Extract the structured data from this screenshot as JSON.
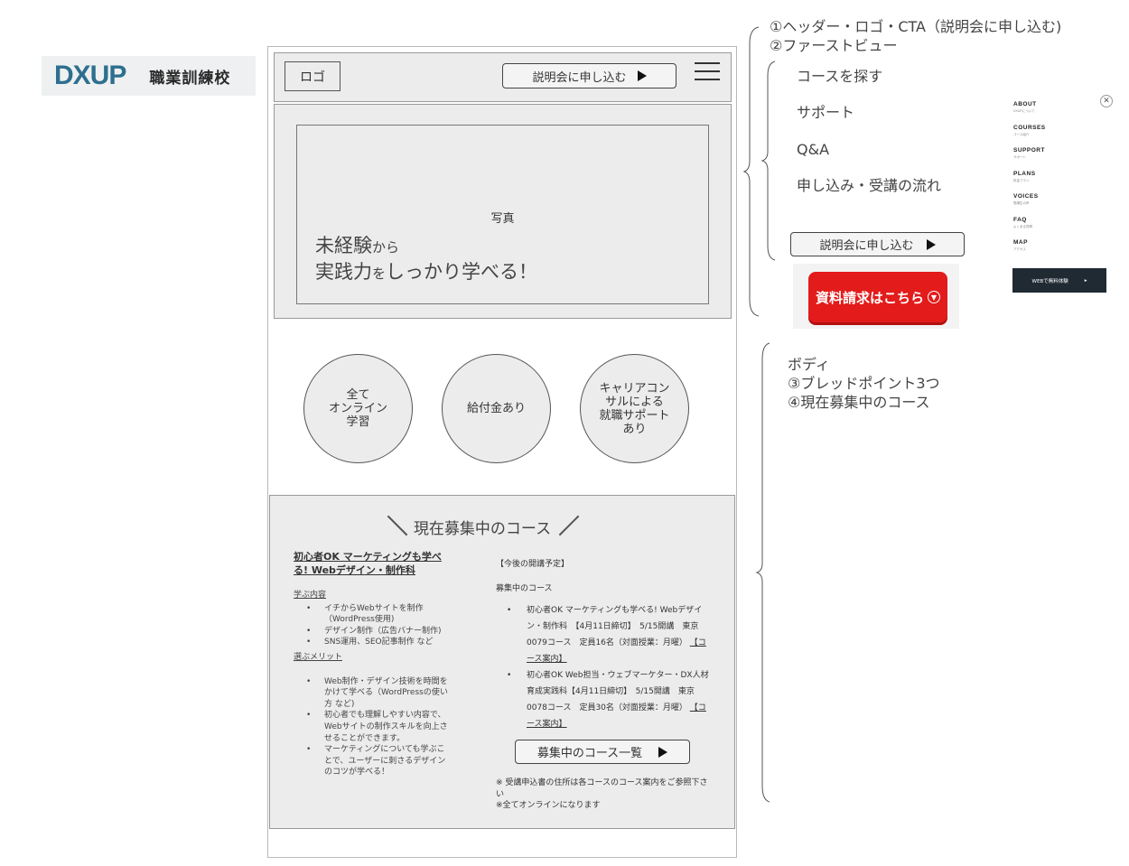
{
  "brand": {
    "mark": "DXUP",
    "text": "職業訓練校"
  },
  "header": {
    "logo_label": "ロゴ",
    "cta_label": "説明会に申し込む"
  },
  "hero": {
    "photo_label": "写真",
    "catch_line1_a": "未経験",
    "catch_line1_b": "から",
    "catch_line2_a": "実践力",
    "catch_line2_b": "を",
    "catch_line2_c": "しっかり学べる！"
  },
  "bullets": [
    {
      "lines": [
        "全て",
        "オンライン",
        "学習"
      ]
    },
    {
      "lines": [
        "給付金あり"
      ]
    },
    {
      "lines": [
        "キャリアコン",
        "サルによる",
        "就職サポート",
        "あり"
      ]
    }
  ],
  "courses": {
    "title": "現在募集中のコース",
    "left": {
      "heading": "初心者OK マーケティングも学べる! Webデザイン・制作科",
      "learn_label": "学ぶ内容",
      "learn_items": [
        "イチからWebサイトを制作（WordPress使用)",
        "デザイン制作（広告バナー制作)",
        "SNS運用、SEO記事制作 など"
      ],
      "merit_label": "選ぶメリット",
      "merit_items": [
        "Web制作・デザイン技術を時間をかけて学べる（WordPressの使い方 など)",
        "初心者でも理解しやすい内容で、Webサイトの制作スキルを向上させることができます。",
        "マーケティングについても学ぶことで、ユーザーに刺さるデザインのコツが学べる！"
      ]
    },
    "right": {
      "schedule_label": "【今後の開講予定】",
      "open_label": "募集中のコース",
      "items": [
        {
          "text": "初心者OK マーケティングも学べる! Webデザイン・制作科　【4月11日締切】　5/15開講　東京0079コース　定員16名（対面授業：月曜）",
          "link": "【コース案内】"
        },
        {
          "text": "初心者OK Web担当・ウェブマーケター・DX人材育成実践科【4月11日締切】　5/15開講　東京0078コース　定員30名（対面授業：月曜）",
          "link": "【コース案内】"
        }
      ],
      "list_button": "募集中のコース一覧",
      "note1": "※ 受講申込書の住所は各コースのコース案内をご参照下さい",
      "note2": "※全てオンラインになります"
    }
  },
  "annotations": {
    "header_note1": "①ヘッダー・ロゴ・CTA（説明会に申し込む)",
    "header_note2": "②ファーストビュー",
    "body_note1": "ボディ",
    "body_note2": "③ブレッドポイント3つ",
    "body_note3": "④現在募集中のコース"
  },
  "menu": {
    "items": [
      "コースを探す",
      "サポート",
      "Q&A",
      "申し込み・受講の流れ"
    ],
    "cta_label": "説明会に申し込む",
    "red_button": "資料請求はこちら"
  },
  "side_menu": {
    "items": [
      {
        "en": "ABOUT",
        "jp": "DXUPについて"
      },
      {
        "en": "COURSES",
        "jp": "コース紹介"
      },
      {
        "en": "SUPPORT",
        "jp": "サポート"
      },
      {
        "en": "PLANS",
        "jp": "料金プラン"
      },
      {
        "en": "VOICES",
        "jp": "受講生の声"
      },
      {
        "en": "FAQ",
        "jp": "よくある質問"
      },
      {
        "en": "MAP",
        "jp": "アクセス"
      }
    ],
    "button_label": "WEBで無料体験"
  },
  "colors": {
    "red": "#e31b1b",
    "brand": "#2e6f8e",
    "dark": "#1f2a33"
  }
}
